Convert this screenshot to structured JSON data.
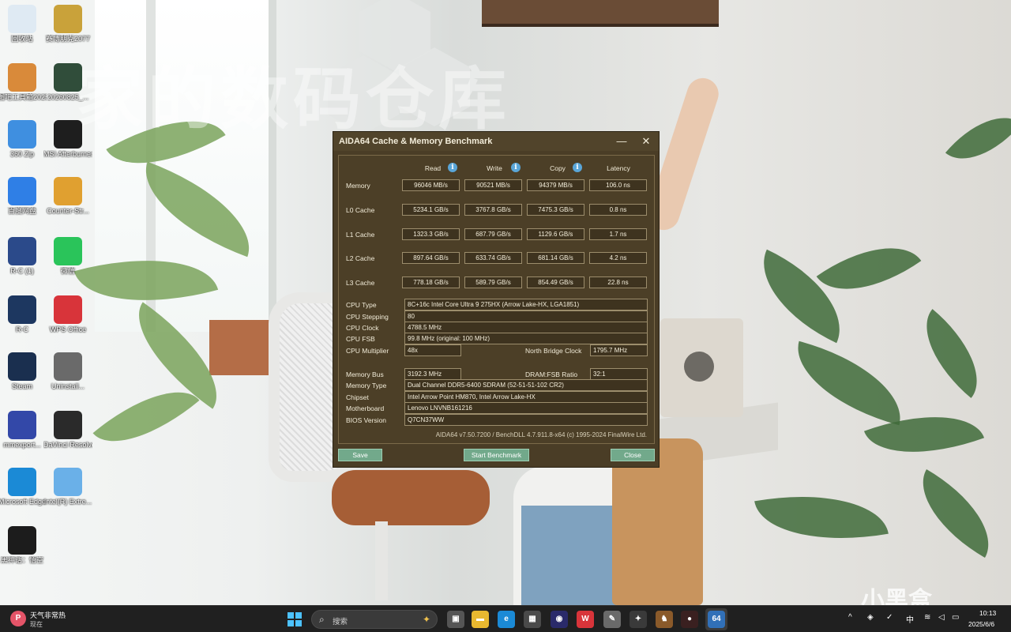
{
  "watermark": "家的数码仓库",
  "brand_mark": "小黑盒",
  "desktop_icons": [
    {
      "label": "回收站",
      "color": "#dfeaf3"
    },
    {
      "label": "赛博朋克2077",
      "color": "#c9a23a"
    },
    {
      "label": "图吧工具箱2025",
      "color": "#d98a3a"
    },
    {
      "label": "20260825_...",
      "color": "#304d3a"
    },
    {
      "label": "360 Zip",
      "color": "#3f8fe0"
    },
    {
      "label": "MSI Afterburner",
      "color": "#1e1e1e"
    },
    {
      "label": "百度网盘",
      "color": "#2f7fe6"
    },
    {
      "label": "Counter-Str...",
      "color": "#e0a030"
    },
    {
      "label": "R-C (1)",
      "color": "#2b4a8a"
    },
    {
      "label": "微信",
      "color": "#2ac45a"
    },
    {
      "label": "R-C",
      "color": "#1d3760"
    },
    {
      "label": "WPS Office",
      "color": "#d8343a"
    },
    {
      "label": "Steam",
      "color": "#1a2f4f"
    },
    {
      "label": "Uninstall...",
      "color": "#6a6a6a"
    },
    {
      "label": "mmexport...",
      "color": "#3348a8"
    },
    {
      "label": "DaVinci Resolve",
      "color": "#2a2a2a"
    },
    {
      "label": "Microsoft Edge",
      "color": "#1b8ad6"
    },
    {
      "label": "Intel(R) Extre...",
      "color": "#6ab0e8"
    },
    {
      "label": "黑神话：悟空",
      "color": "#1c1c1c"
    }
  ],
  "aida": {
    "title": "AIDA64 Cache & Memory Benchmark",
    "minimize": "—",
    "close_glyph": "✕",
    "headers": {
      "read": "Read",
      "write": "Write",
      "copy": "Copy",
      "latency": "Latency"
    },
    "info_glyph": "i",
    "bench_rows": [
      {
        "label": "Memory",
        "read": "96046 MB/s",
        "write": "90521 MB/s",
        "copy": "94379 MB/s",
        "latency": "106.0 ns"
      },
      {
        "label": "L0 Cache",
        "read": "5234.1 GB/s",
        "write": "3767.8 GB/s",
        "copy": "7475.3 GB/s",
        "latency": "0.8 ns"
      },
      {
        "label": "L1 Cache",
        "read": "1323.3 GB/s",
        "write": "687.79 GB/s",
        "copy": "1129.6 GB/s",
        "latency": "1.7 ns"
      },
      {
        "label": "L2 Cache",
        "read": "897.64 GB/s",
        "write": "633.74 GB/s",
        "copy": "681.14 GB/s",
        "latency": "4.2 ns"
      },
      {
        "label": "L3 Cache",
        "read": "778.18 GB/s",
        "write": "589.79 GB/s",
        "copy": "854.49 GB/s",
        "latency": "22.8 ns"
      }
    ],
    "cpu": {
      "type_label": "CPU Type",
      "type": "8C+16c Intel Core Ultra 9 275HX  (Arrow Lake-HX, LGA1851)",
      "stepping_label": "CPU Stepping",
      "stepping": "80",
      "clock_label": "CPU Clock",
      "clock": "4788.5 MHz",
      "fsb_label": "CPU FSB",
      "fsb": "99.8 MHz  (original: 100 MHz)",
      "multiplier_label": "CPU Multiplier",
      "multiplier": "48x",
      "nb_label": "North Bridge Clock",
      "nb": "1795.7 MHz"
    },
    "mem": {
      "bus_label": "Memory Bus",
      "bus": "3192.3 MHz",
      "ratio_label": "DRAM:FSB Ratio",
      "ratio": "32:1",
      "type_label": "Memory Type",
      "type": "Dual Channel DDR5-6400 SDRAM  (52-51-51-102 CR2)",
      "chipset_label": "Chipset",
      "chipset": "Intel Arrow Point HM870, Intel Arrow Lake-HX",
      "mobo_label": "Motherboard",
      "mobo": "Lenovo LNVNB161216",
      "bios_label": "BIOS Version",
      "bios": "Q7CN37WW"
    },
    "footer": "AIDA64 v7.50.7200 / BenchDLL 4.7.911.8-x64  (c) 1995-2024 FinalWire Ltd.",
    "buttons": {
      "save": "Save",
      "start": "Start Benchmark",
      "close": "Close"
    }
  },
  "taskbar": {
    "weather_glyph": "P",
    "weather_title": "天气非常热",
    "weather_sub": "现在",
    "search_placeholder": "搜索",
    "apps": [
      {
        "name": "task-view-icon",
        "glyph": "▣",
        "color": "#555555"
      },
      {
        "name": "file-explorer-icon",
        "glyph": "▬",
        "color": "#e8b830"
      },
      {
        "name": "edge-icon",
        "glyph": "e",
        "color": "#1b8ad6"
      },
      {
        "name": "store-icon",
        "glyph": "▦",
        "color": "#4a4a4a"
      },
      {
        "name": "app-face-icon",
        "glyph": "◉",
        "color": "#2a2a6a"
      },
      {
        "name": "wps-icon",
        "glyph": "W",
        "color": "#d8343a"
      },
      {
        "name": "tool-icon",
        "glyph": "✎",
        "color": "#6a6a6a"
      },
      {
        "name": "game-icon",
        "glyph": "✦",
        "color": "#3a3a3a"
      },
      {
        "name": "pet-icon",
        "glyph": "♞",
        "color": "#8a5a2a"
      },
      {
        "name": "record-icon",
        "glyph": "●",
        "color": "#3a2020"
      },
      {
        "name": "aida64-icon",
        "glyph": "64",
        "color": "#3170b8"
      }
    ],
    "tray_chevron": "^",
    "tray_ime": "中",
    "clock_time": "10:13",
    "clock_date": "2025/6/6"
  }
}
